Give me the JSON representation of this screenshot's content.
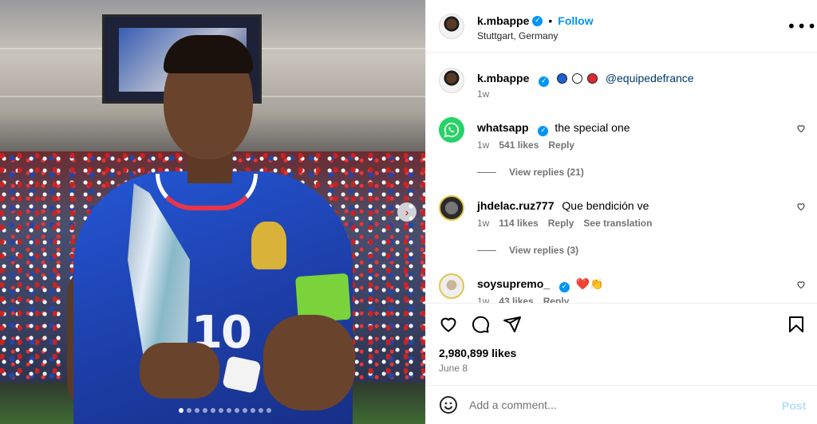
{
  "post": {
    "username": "k.mbappe",
    "verified": true,
    "separator": "•",
    "follow_label": "Follow",
    "location": "Stuttgart, Germany",
    "more_icon": "more-horizontal-icon",
    "jersey_number": "10"
  },
  "caption": {
    "username": "k.mbappe",
    "mention": "@equipedefrance",
    "flag_colors": [
      "#1f5fd1",
      "#ffffff",
      "#e0282e"
    ],
    "time": "1w"
  },
  "comments": [
    {
      "username": "whatsapp",
      "verified": true,
      "text": "the special one",
      "time": "1w",
      "likes": "541 likes",
      "reply_label": "Reply",
      "view_replies": "View replies (21)",
      "avatar_color": "#25d366"
    },
    {
      "username": "jhdelac.ruz777",
      "verified": false,
      "text": "Que bendición ve",
      "time": "1w",
      "likes": "114 likes",
      "reply_label": "Reply",
      "see_translation": "See translation",
      "view_replies": "View replies (3)"
    },
    {
      "username": "soysupremo_",
      "verified": true,
      "text": "❤️👏",
      "time": "1w",
      "likes": "43 likes",
      "reply_label": "Reply"
    }
  ],
  "actions": {
    "likes": "2,980,899 likes",
    "date": "June 8"
  },
  "add_comment": {
    "placeholder": "Add a comment...",
    "post_label": "Post"
  },
  "colors": {
    "accent": "#0095f6",
    "muted": "#737373",
    "link": "#00376b",
    "post_disabled": "#b2dffc"
  },
  "carousel": {
    "dot_count": 12,
    "active_index": 0,
    "next_icon": "chevron-right-icon"
  }
}
